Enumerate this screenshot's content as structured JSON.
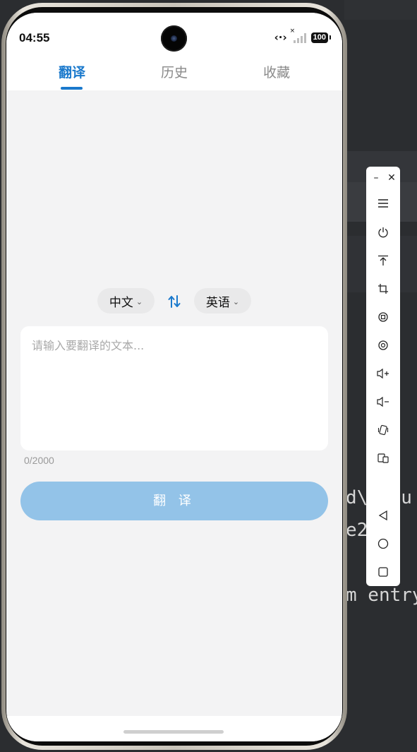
{
  "status_bar": {
    "time": "04:55",
    "battery": "100"
  },
  "tabs": [
    {
      "label": "翻译",
      "active": true
    },
    {
      "label": "历史",
      "active": false
    },
    {
      "label": "收藏",
      "active": false
    }
  ],
  "translator": {
    "source_lang": "中文",
    "target_lang": "英语",
    "input_placeholder": "请输入要翻译的文本...",
    "input_value": "",
    "char_count": "0/2000",
    "translate_button": "翻 译"
  },
  "background_code": {
    "line1": "d\\ fau",
    "line2": "e2  f",
    "line3": "m entry"
  },
  "colors": {
    "accent": "#1a79cc",
    "button_disabled": "#93c3e8",
    "page_bg": "#f3f3f4"
  },
  "emulator_toolbar": {
    "icons": [
      "minimize-icon",
      "close-icon",
      "menu-icon",
      "power-icon",
      "pin-top-icon",
      "crop-icon",
      "rotate-left-icon",
      "rotate-right-icon",
      "volume-up-icon",
      "volume-down-icon",
      "shake-icon",
      "multi-screen-icon",
      "back-icon",
      "home-icon",
      "recents-icon"
    ]
  }
}
